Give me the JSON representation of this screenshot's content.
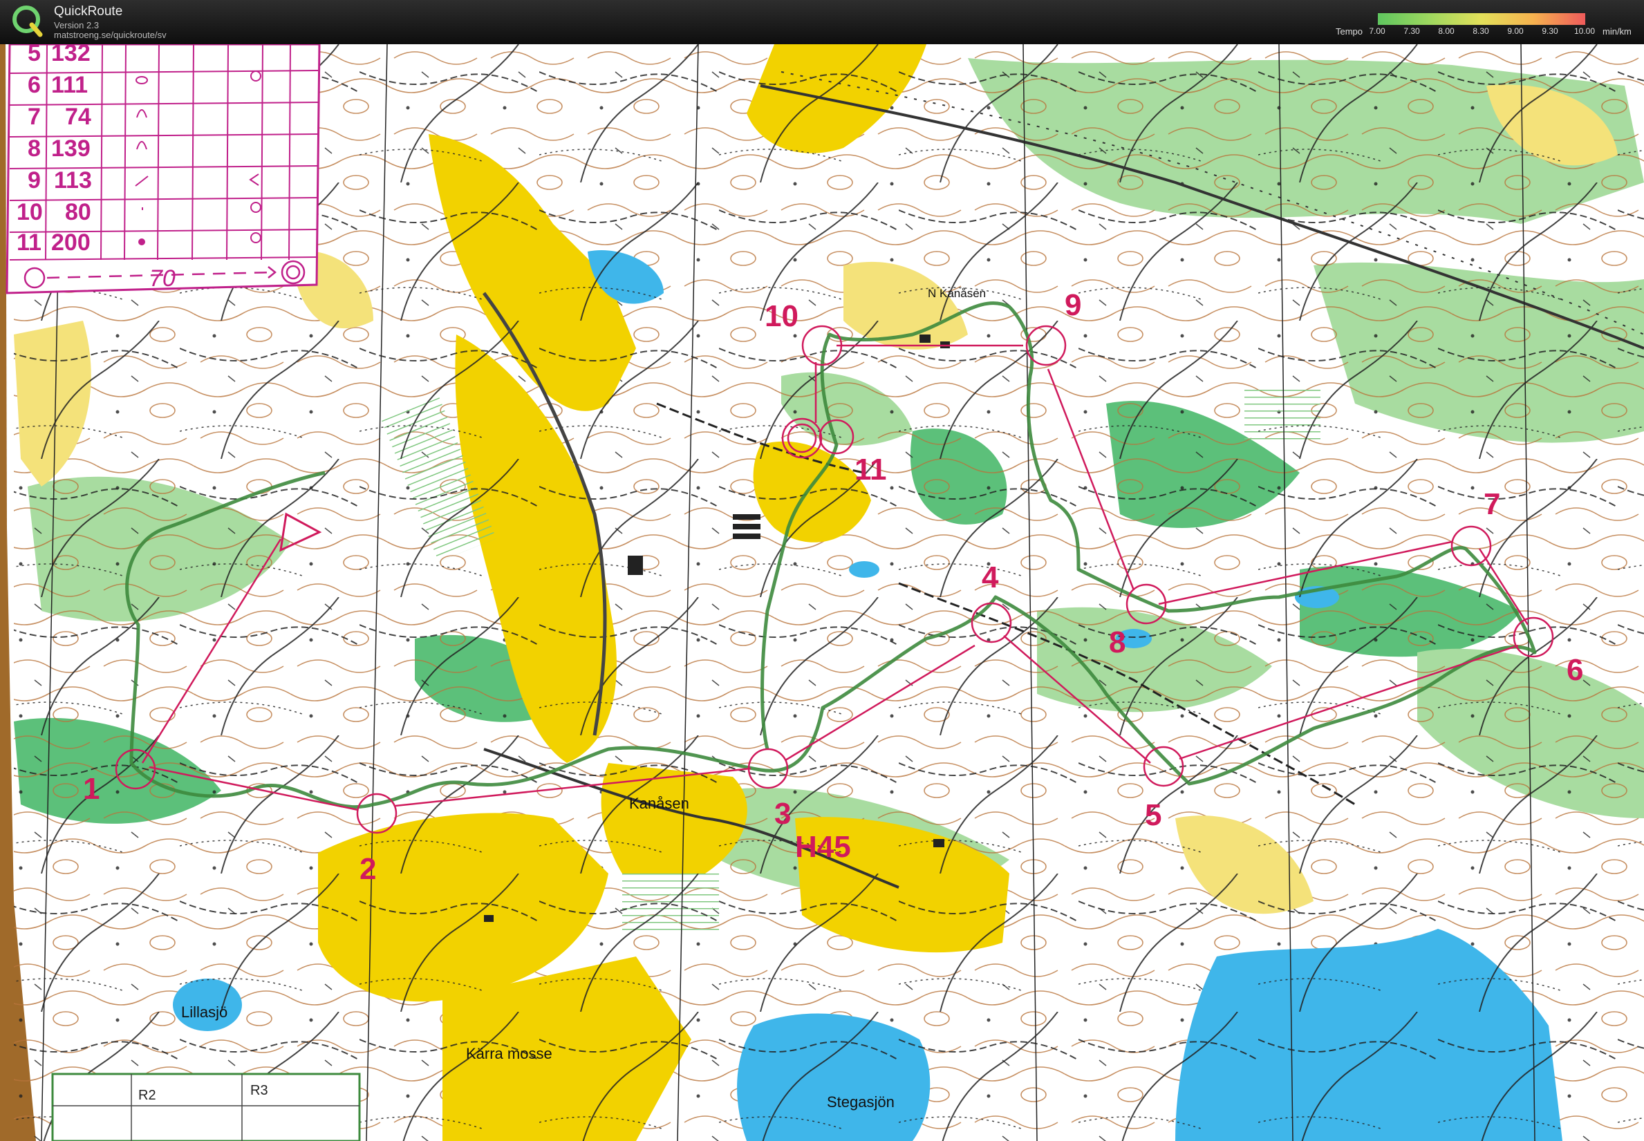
{
  "app": {
    "title": "QuickRoute",
    "version": "Version 2.3",
    "url": "matstroeng.se/quickroute/sv"
  },
  "tempo_legend": {
    "title": "Tempo",
    "ticks": [
      "7.00",
      "7.30",
      "8.00",
      "8.30",
      "9.00",
      "9.30",
      "10.00"
    ],
    "unit": "min/km",
    "colors": [
      "#5fc65f",
      "#9ed85f",
      "#e3e05a",
      "#f6b24f",
      "#ef5b5b"
    ]
  },
  "course_table": {
    "rows": [
      {
        "control": "5",
        "code": "132"
      },
      {
        "control": "6",
        "code": "111"
      },
      {
        "control": "7",
        "code": "74"
      },
      {
        "control": "8",
        "code": "139"
      },
      {
        "control": "9",
        "code": "113"
      },
      {
        "control": "10",
        "code": "80"
      },
      {
        "control": "11",
        "code": "200"
      }
    ],
    "finish_distance": "70"
  },
  "controls": [
    {
      "label": "1"
    },
    {
      "label": "2"
    },
    {
      "label": "3"
    },
    {
      "label": "4"
    },
    {
      "label": "5"
    },
    {
      "label": "6"
    },
    {
      "label": "7"
    },
    {
      "label": "8"
    },
    {
      "label": "9"
    },
    {
      "label": "10"
    },
    {
      "label": "11"
    }
  ],
  "course_class": "H45",
  "place_names": {
    "n_kanasen": "N Kanåsen",
    "kanasen": "Kanåsen",
    "lillasjo": "Lillasjö",
    "karra_mosse": "Kärra mosse",
    "stegasjon": "Stegasjön"
  },
  "bottom_table": {
    "headers": [
      "R2",
      "R3"
    ]
  },
  "colors": {
    "course": "#d01a5c",
    "route": "#3d8a3d",
    "forest": "#ffffff",
    "open": "#f2d200",
    "rough_open": "#f4e27a",
    "green": "#5cc07a",
    "light_green": "#a8dca0",
    "water": "#3fb6ea",
    "contour": "#b8733a"
  }
}
